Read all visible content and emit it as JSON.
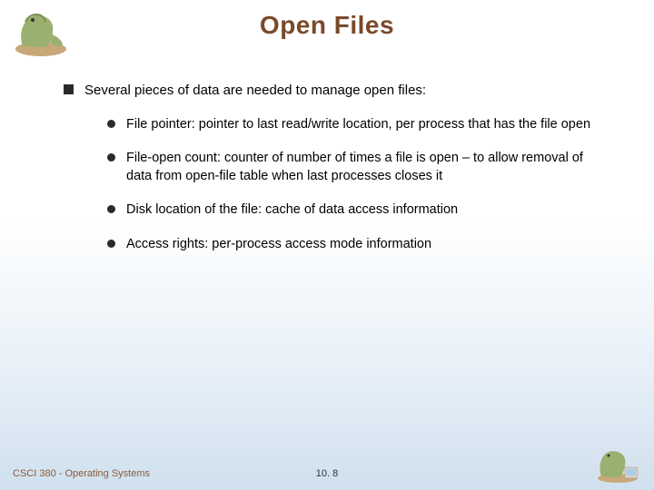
{
  "title": "Open Files",
  "main_bullet": "Several pieces of data are needed to manage open files:",
  "sub_bullets": [
    "File pointer:  pointer to last read/write location, per process that has the file open",
    "File-open count: counter of number of times a file is open – to allow removal of data from open-file table when last processes closes it",
    "Disk location of the file: cache of data access information",
    "Access rights: per-process access mode information"
  ],
  "footer": {
    "left": "CSCI 380 - Operating Systems",
    "center": "10. 8"
  },
  "logo_alt": "dinosaur-mascot"
}
